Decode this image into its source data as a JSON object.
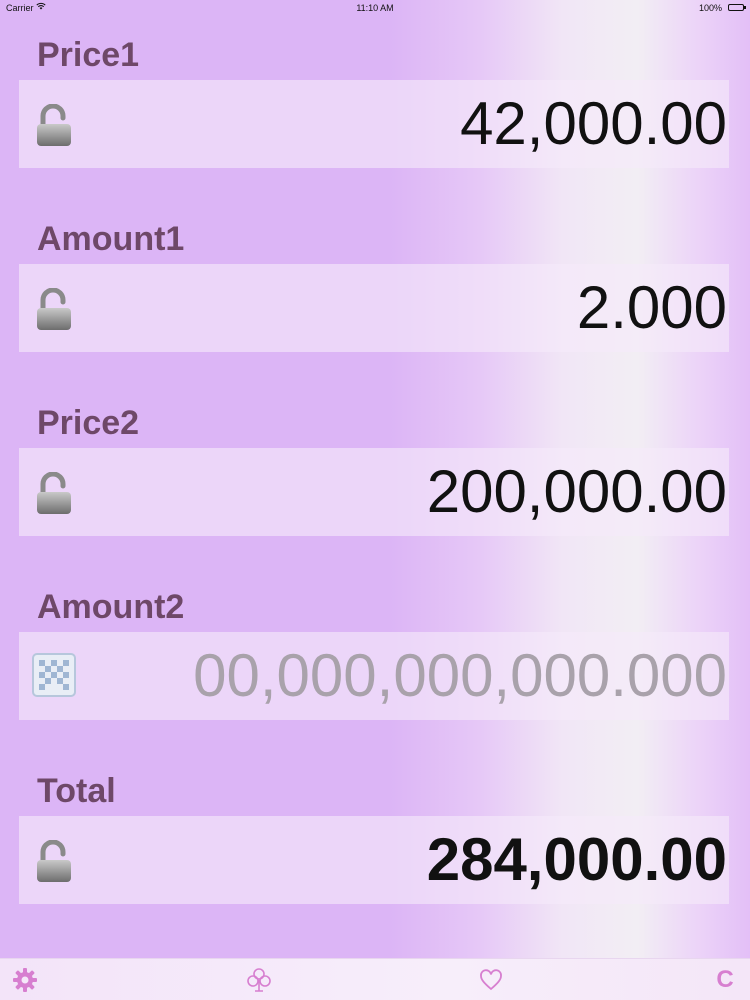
{
  "status_bar": {
    "carrier": "Carrier",
    "time": "11:10 AM",
    "battery": "100%"
  },
  "fields": [
    {
      "label": "Price1",
      "value": "42,000.00",
      "icon": "unlock-icon"
    },
    {
      "label": "Amount1",
      "value": "2.000",
      "icon": "unlock-icon"
    },
    {
      "label": "Price2",
      "value": "200,000.00",
      "icon": "unlock-icon"
    },
    {
      "label": "Amount2",
      "placeholder": "00,000,000,000.000",
      "icon": "calculate-dice-icon"
    },
    {
      "label": "Total",
      "value": "284,000.00",
      "icon": "unlock-icon"
    }
  ],
  "tab_bar": {
    "clear_label": "C",
    "icons": [
      "gear-icon",
      "club-icon",
      "heart-icon"
    ]
  },
  "colors": {
    "label": "#6e4868",
    "accent": "#d77fd0",
    "placeholder": "#a9a2ab"
  }
}
